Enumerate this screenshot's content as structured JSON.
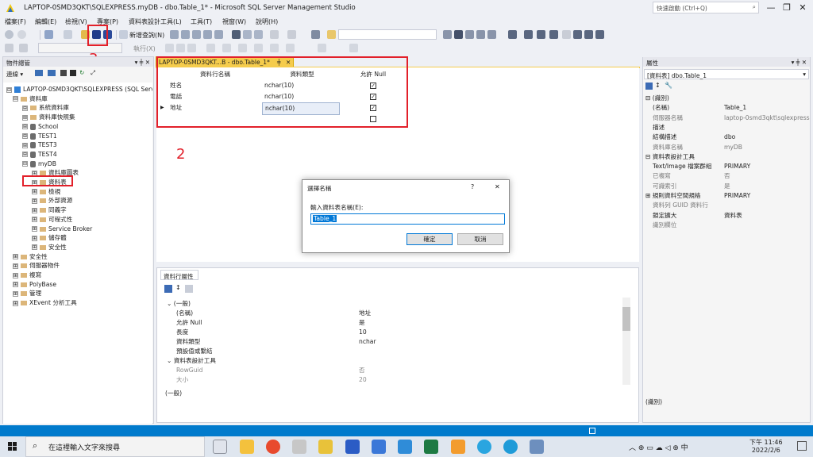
{
  "window": {
    "title": "LAPTOP-0SMD3QKT\\SQLEXPRESS.myDB - dbo.Table_1* - Microsoft SQL Server Management Studio",
    "quick_launch": "快速啟動 (Ctrl+Q)",
    "min": "—",
    "restore": "❐",
    "close": "✕"
  },
  "menu": [
    "檔案(F)",
    "編輯(E)",
    "檢視(V)",
    "專案(P)",
    "資料表設計工具(L)",
    "工具(T)",
    "視窗(W)",
    "說明(H)"
  ],
  "toolbar": {
    "new_query": "新增查詢(N)",
    "execute": "執行(X)"
  },
  "object_explorer": {
    "title": "物件總管",
    "connect": "連線 ▾",
    "pin": "▾ ╪ ✕",
    "nodes": [
      {
        "label": "LAPTOP-0SMD3QKT\\SQLEXPRESS (SQL Server",
        "exp": "⊟",
        "icon": "srv"
      },
      {
        "label": "資料庫",
        "exp": "⊟",
        "icon": "fold"
      },
      {
        "label": "系統資料庫",
        "exp": "⊞",
        "icon": "fold"
      },
      {
        "label": "資料庫快照集",
        "exp": "⊞",
        "icon": "fold"
      },
      {
        "label": "School",
        "exp": "⊞",
        "icon": "db"
      },
      {
        "label": "TEST1",
        "exp": "⊞",
        "icon": "db"
      },
      {
        "label": "TEST3",
        "exp": "⊞",
        "icon": "db"
      },
      {
        "label": "TEST4",
        "exp": "⊞",
        "icon": "db"
      },
      {
        "label": "myDB",
        "exp": "⊟",
        "icon": "db"
      },
      {
        "label": "資料庫圖表",
        "exp": "⊞",
        "icon": "fold"
      },
      {
        "label": "資料表",
        "exp": "⊞",
        "icon": "fold"
      },
      {
        "label": "檢視",
        "exp": "⊞",
        "icon": "fold"
      },
      {
        "label": "外部資源",
        "exp": "⊞",
        "icon": "fold"
      },
      {
        "label": "同義字",
        "exp": "⊞",
        "icon": "fold"
      },
      {
        "label": "可程式性",
        "exp": "⊞",
        "icon": "fold"
      },
      {
        "label": "Service Broker",
        "exp": "⊞",
        "icon": "fold"
      },
      {
        "label": "儲存體",
        "exp": "⊞",
        "icon": "fold"
      },
      {
        "label": "安全性",
        "exp": "⊞",
        "icon": "fold"
      },
      {
        "label": "安全性",
        "exp": "⊞",
        "icon": "fold"
      },
      {
        "label": "伺服器物件",
        "exp": "⊞",
        "icon": "fold"
      },
      {
        "label": "複寫",
        "exp": "⊞",
        "icon": "fold"
      },
      {
        "label": "PolyBase",
        "exp": "⊞",
        "icon": "fold"
      },
      {
        "label": "管理",
        "exp": "⊞",
        "icon": "fold"
      },
      {
        "label": "XEvent 分析工具",
        "exp": "⊞",
        "icon": "fold"
      }
    ]
  },
  "tab": {
    "label": "LAPTOP-0SMD3QKT...B - dbo.Table_1*",
    "pin": "╪",
    "close": "✕"
  },
  "designer": {
    "headers": [
      "資料行名稱",
      "資料類型",
      "允許 Null"
    ],
    "rows": [
      {
        "name": "姓名",
        "type": "nchar(10)",
        "null": "✓"
      },
      {
        "name": "電話",
        "type": "nchar(10)",
        "null": "✓"
      },
      {
        "name": "地址",
        "type": "nchar(10)",
        "null": "✓"
      },
      {
        "name": "",
        "type": "",
        "null": ""
      }
    ]
  },
  "annotations": {
    "a2": "2",
    "a3": "3"
  },
  "column_props": {
    "tab": "資料行屬性",
    "section1": "(一般)",
    "items": [
      [
        "(名稱)",
        "地址"
      ],
      [
        "允許 Null",
        "是"
      ],
      [
        "長度",
        "10"
      ],
      [
        "資料類型",
        "nchar"
      ],
      [
        "預設值或繫結",
        ""
      ]
    ],
    "section2": "資料表設計工具",
    "items2": [
      [
        "RowGuid",
        "否"
      ],
      [
        "大小",
        "20"
      ]
    ],
    "footer": "(一般)"
  },
  "properties": {
    "title": "屬性",
    "pin": "▾ ╪ ✕",
    "selector": "[資料表] dbo.Table_1",
    "rows": [
      [
        "⊟ (識別)",
        ""
      ],
      [
        "(名稱)",
        "Table_1"
      ],
      [
        "伺服器名稱",
        "laptop-0smd3qkt\\sqlexpress"
      ],
      [
        "描述",
        ""
      ],
      [
        "結構描述",
        "dbo"
      ],
      [
        "資料庫名稱",
        "myDB"
      ],
      [
        "⊟ 資料表設計工具",
        ""
      ],
      [
        "Text/Image 檔案群組",
        "PRIMARY"
      ],
      [
        "已複寫",
        "否"
      ],
      [
        "可識索引",
        "是"
      ],
      [
        "⊞ 規則資料空間規格",
        "PRIMARY"
      ],
      [
        "資料列 GUID 資料行",
        ""
      ],
      [
        "鎖定擴大",
        "資料表"
      ],
      [
        "識別欄位",
        ""
      ]
    ],
    "footer": "(識別)"
  },
  "dialog": {
    "title": "選擇名稱",
    "help": "?",
    "close": "✕",
    "prompt": "輸入資料表名稱(E):",
    "value": "Table_1",
    "ok": "確定",
    "cancel": "取消"
  },
  "taskbar": {
    "search": "在這裡輸入文字來搜尋",
    "time": "下午 11:46",
    "date": "2022/2/6",
    "ime": "中",
    "tray": "︿ ⊕ ▭ ☁ ◁ ⊕ 中"
  }
}
